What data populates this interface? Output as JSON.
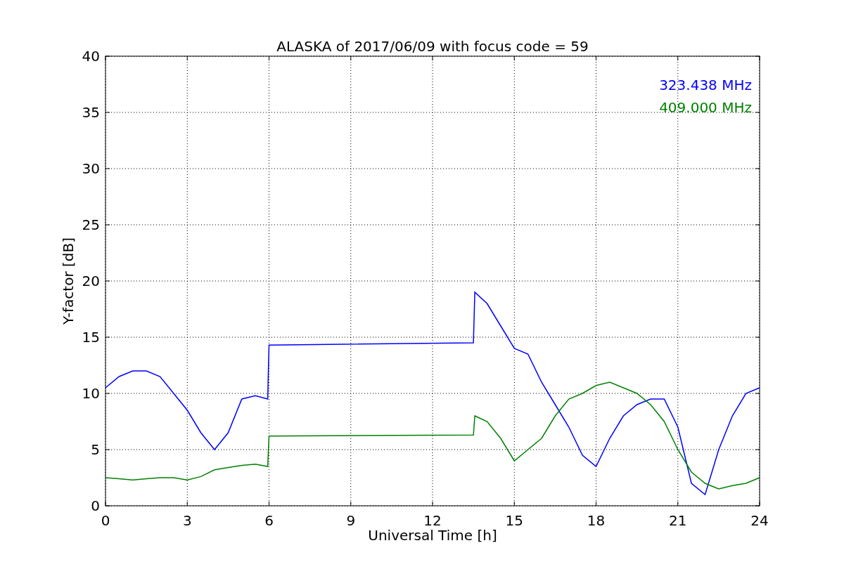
{
  "chart_data": {
    "type": "line",
    "title": "ALASKA of 2017/06/09 with focus code = 59",
    "xlabel": "Universal Time [h]",
    "ylabel": "Y-factor [dB]",
    "x": [
      0,
      0.5,
      1,
      1.5,
      2,
      2.5,
      3,
      3.5,
      4,
      4.5,
      5,
      5.5,
      5.95,
      6,
      13.5,
      13.55,
      14,
      14.5,
      15,
      15.5,
      16,
      16.5,
      17,
      17.5,
      18,
      18.5,
      19,
      19.5,
      20,
      20.5,
      21,
      21.5,
      22,
      22.5,
      23,
      23.5,
      24
    ],
    "series": [
      {
        "name": "323.438 MHz",
        "color": "#0000ff",
        "values": [
          10.5,
          11.5,
          12,
          12,
          11.5,
          10,
          8.5,
          6.5,
          5,
          6.5,
          9.5,
          9.8,
          9.5,
          14.3,
          14.5,
          19,
          18,
          16,
          14,
          13.5,
          11,
          9,
          7,
          4.5,
          3.5,
          6,
          8,
          9,
          9.5,
          9.5,
          7,
          2,
          1,
          5,
          8,
          10,
          10.5
        ]
      },
      {
        "name": "409.000 MHz",
        "color": "#008000",
        "values": [
          2.5,
          2.4,
          2.3,
          2.4,
          2.5,
          2.5,
          2.3,
          2.6,
          3.2,
          3.4,
          3.6,
          3.7,
          3.5,
          6.2,
          6.3,
          8,
          7.5,
          6,
          4,
          5,
          6,
          8,
          9.5,
          10,
          10.7,
          11,
          10.5,
          10,
          9,
          7.5,
          5,
          3,
          2,
          1.5,
          1.8,
          2,
          2.5
        ]
      }
    ],
    "xlim": [
      0,
      24
    ],
    "ylim": [
      0,
      40
    ],
    "xticks": [
      0,
      3,
      6,
      9,
      12,
      15,
      18,
      21,
      24
    ],
    "yticks": [
      0,
      5,
      10,
      15,
      20,
      25,
      30,
      35,
      40
    ],
    "grid": true
  }
}
